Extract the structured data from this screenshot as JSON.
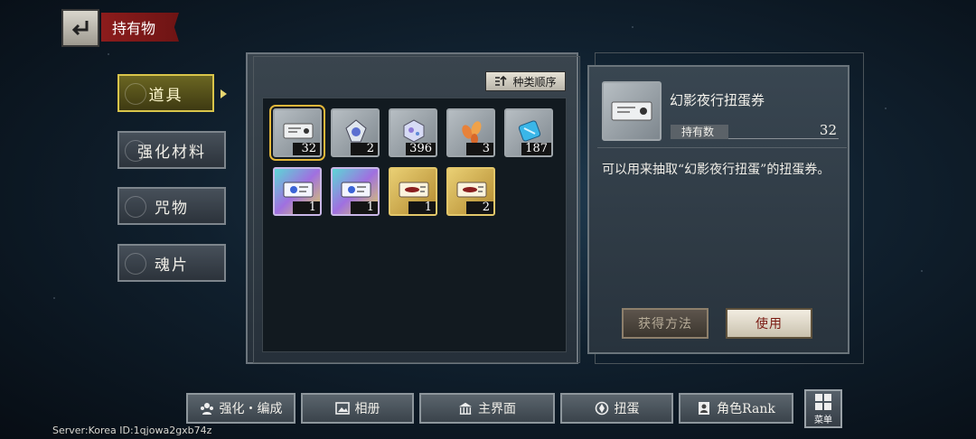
{
  "header": {
    "title": "持有物"
  },
  "categories": [
    {
      "label": "道具",
      "active": true
    },
    {
      "label": "强化材料",
      "active": false
    },
    {
      "label": "咒物",
      "active": false
    },
    {
      "label": "魂片",
      "active": false
    }
  ],
  "inventory": {
    "sort_label": "种类顺序",
    "items": [
      {
        "qty": "32",
        "icon": "ticket-icon",
        "frame": "silver",
        "selected": true
      },
      {
        "qty": "2",
        "icon": "charm-icon",
        "frame": "silver"
      },
      {
        "qty": "396",
        "icon": "cube-icon",
        "frame": "silver"
      },
      {
        "qty": "3",
        "icon": "petal-icon",
        "frame": "silver"
      },
      {
        "qty": "187",
        "icon": "scroll-icon",
        "frame": "silver"
      },
      {
        "qty": "1",
        "icon": "ticket-icon",
        "frame": "rainbow"
      },
      {
        "qty": "1",
        "icon": "ticket-icon",
        "frame": "rainbow"
      },
      {
        "qty": "1",
        "icon": "ticket-icon",
        "frame": "gold"
      },
      {
        "qty": "2",
        "icon": "ticket-icon",
        "frame": "gold"
      }
    ]
  },
  "detail": {
    "name": "幻影夜行扭蛋券",
    "owned_label": "持有数",
    "owned_value": "32",
    "description": "可以用来抽取“幻影夜行扭蛋”的扭蛋券。",
    "obtain_label": "获得方法",
    "use_label": "使用"
  },
  "bottom_nav": [
    {
      "label": "强化・编成",
      "icon": "team-icon"
    },
    {
      "label": "相册",
      "icon": "album-icon"
    },
    {
      "label": "主界面",
      "icon": "home-icon"
    },
    {
      "label": "扭蛋",
      "icon": "gacha-icon"
    },
    {
      "label": "角色Rank",
      "icon": "rank-icon"
    }
  ],
  "menu_label": "菜单",
  "server_text": "Server:Korea ID:1qjowa2gxb74z",
  "colors": {
    "accent_gold": "#d9c54a",
    "title_red": "#8c1c1c",
    "use_text": "#7a1a12"
  }
}
